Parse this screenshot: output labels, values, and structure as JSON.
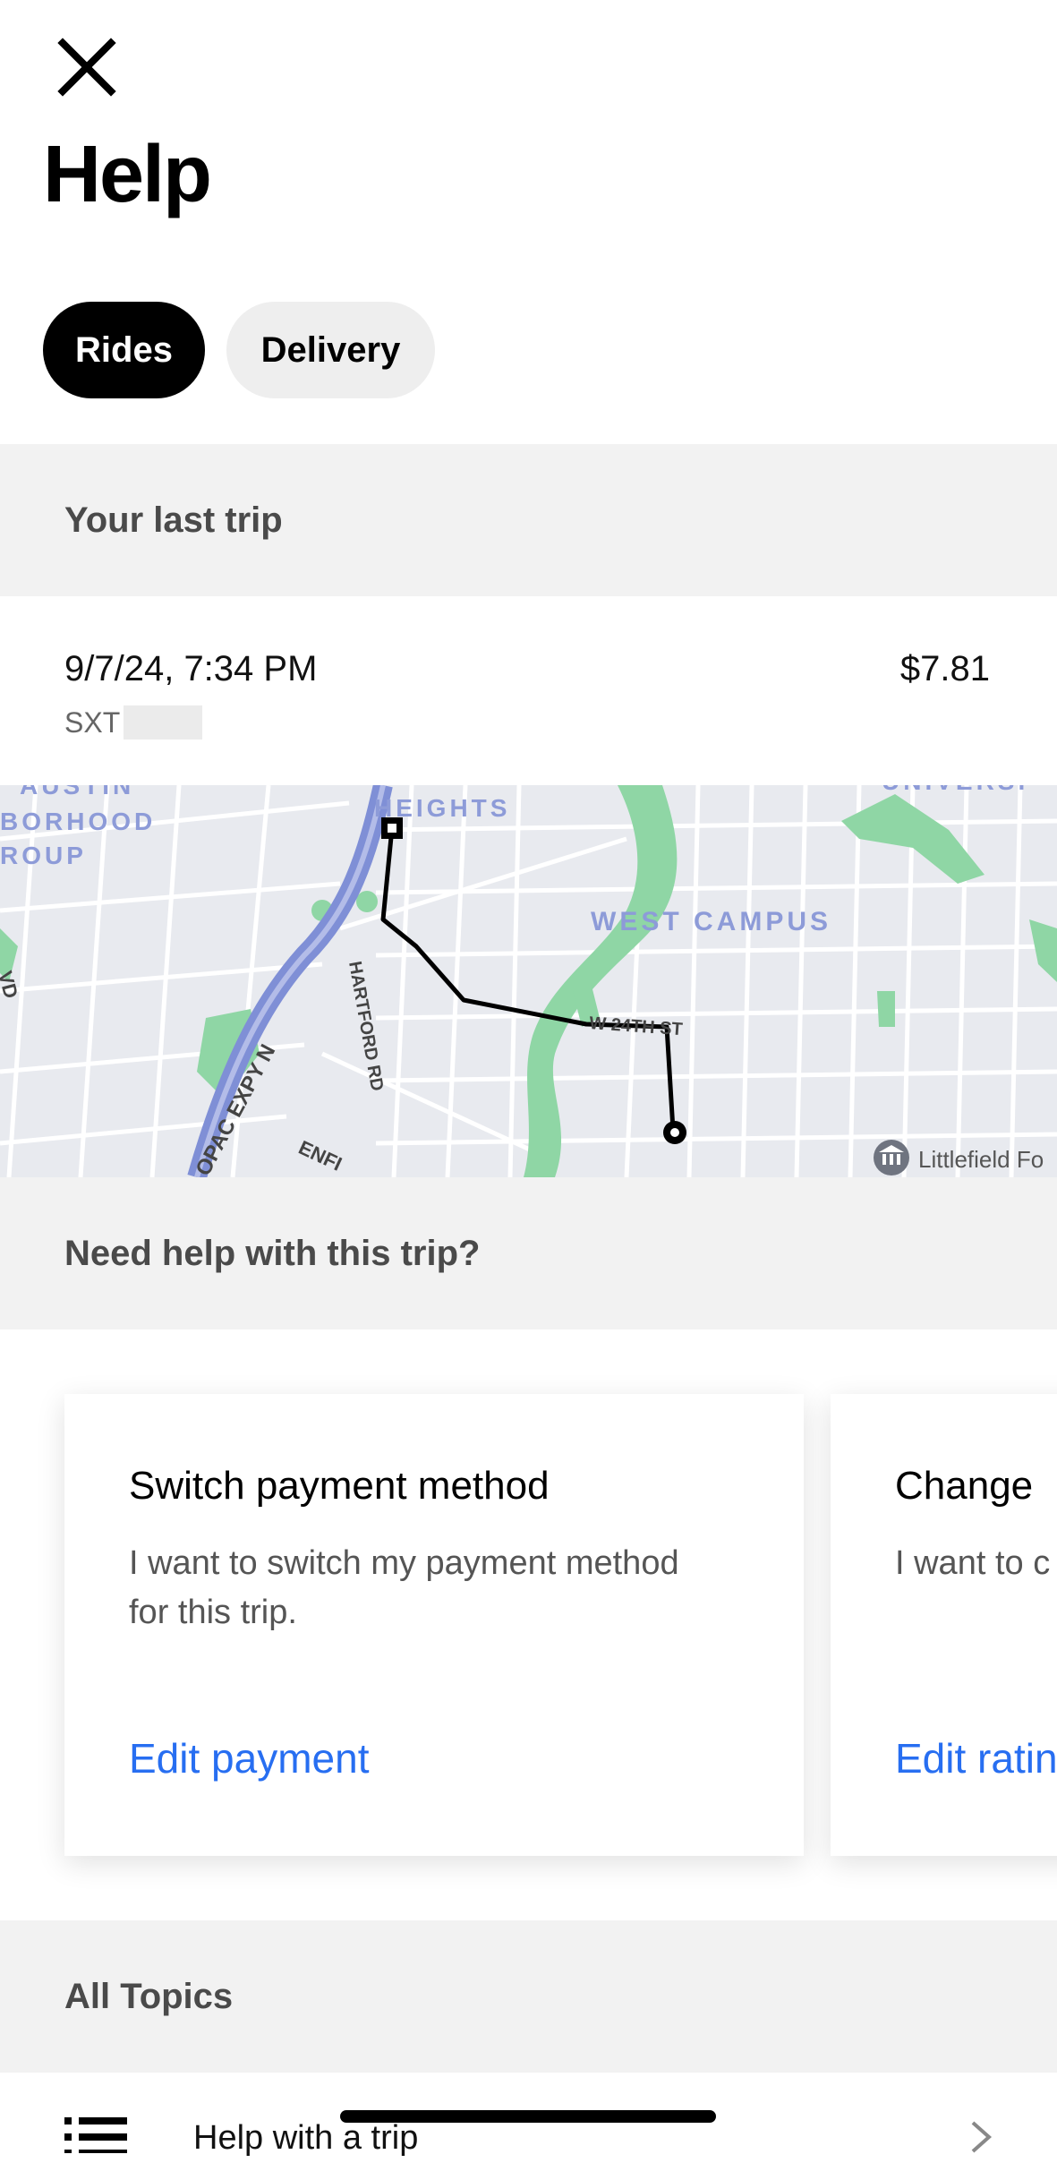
{
  "header": {
    "close_icon": "close-icon",
    "title": "Help"
  },
  "tabs": [
    {
      "label": "Rides",
      "active": true
    },
    {
      "label": "Delivery",
      "active": false
    }
  ],
  "last_trip": {
    "section_label": "Your last trip",
    "datetime": "9/7/24, 7:34 PM",
    "price": "$7.81",
    "plate_prefix": "SXT"
  },
  "map": {
    "labels": {
      "austin": "AUSTIN",
      "borhood": "BORHOOD",
      "roup": "ROUP",
      "heights": "HEIGHTS",
      "univers": "UNIVERSI",
      "west_campus": "WEST CAMPUS",
      "w24th": "W 24TH ST",
      "hartford": "HARTFORD RD",
      "opac": "OPAC EXPY N",
      "enfi": "ENFI",
      "vd": "VD",
      "littlefield": "Littlefield Fo"
    },
    "pickup_marker_icon": "square-marker-icon",
    "dropoff_marker_icon": "circle-marker-icon",
    "poi_icon": "museum-icon",
    "colors": {
      "route": "#000000",
      "park": "#8fd6a5",
      "highway": "#7f8fd6"
    }
  },
  "help_section": {
    "label": "Need help with this trip?",
    "cards": [
      {
        "title": "Switch payment method",
        "description": "I want to switch my payment method for this trip.",
        "action": "Edit payment"
      },
      {
        "title": "Change",
        "description": "I want to c",
        "action": "Edit ratin"
      }
    ]
  },
  "topics": {
    "label": "All Topics",
    "items": [
      {
        "label": "Help with a trip",
        "icon": "list-icon"
      }
    ]
  },
  "colors": {
    "accent": "#276ef1",
    "section_bg": "#f2f2f2"
  }
}
